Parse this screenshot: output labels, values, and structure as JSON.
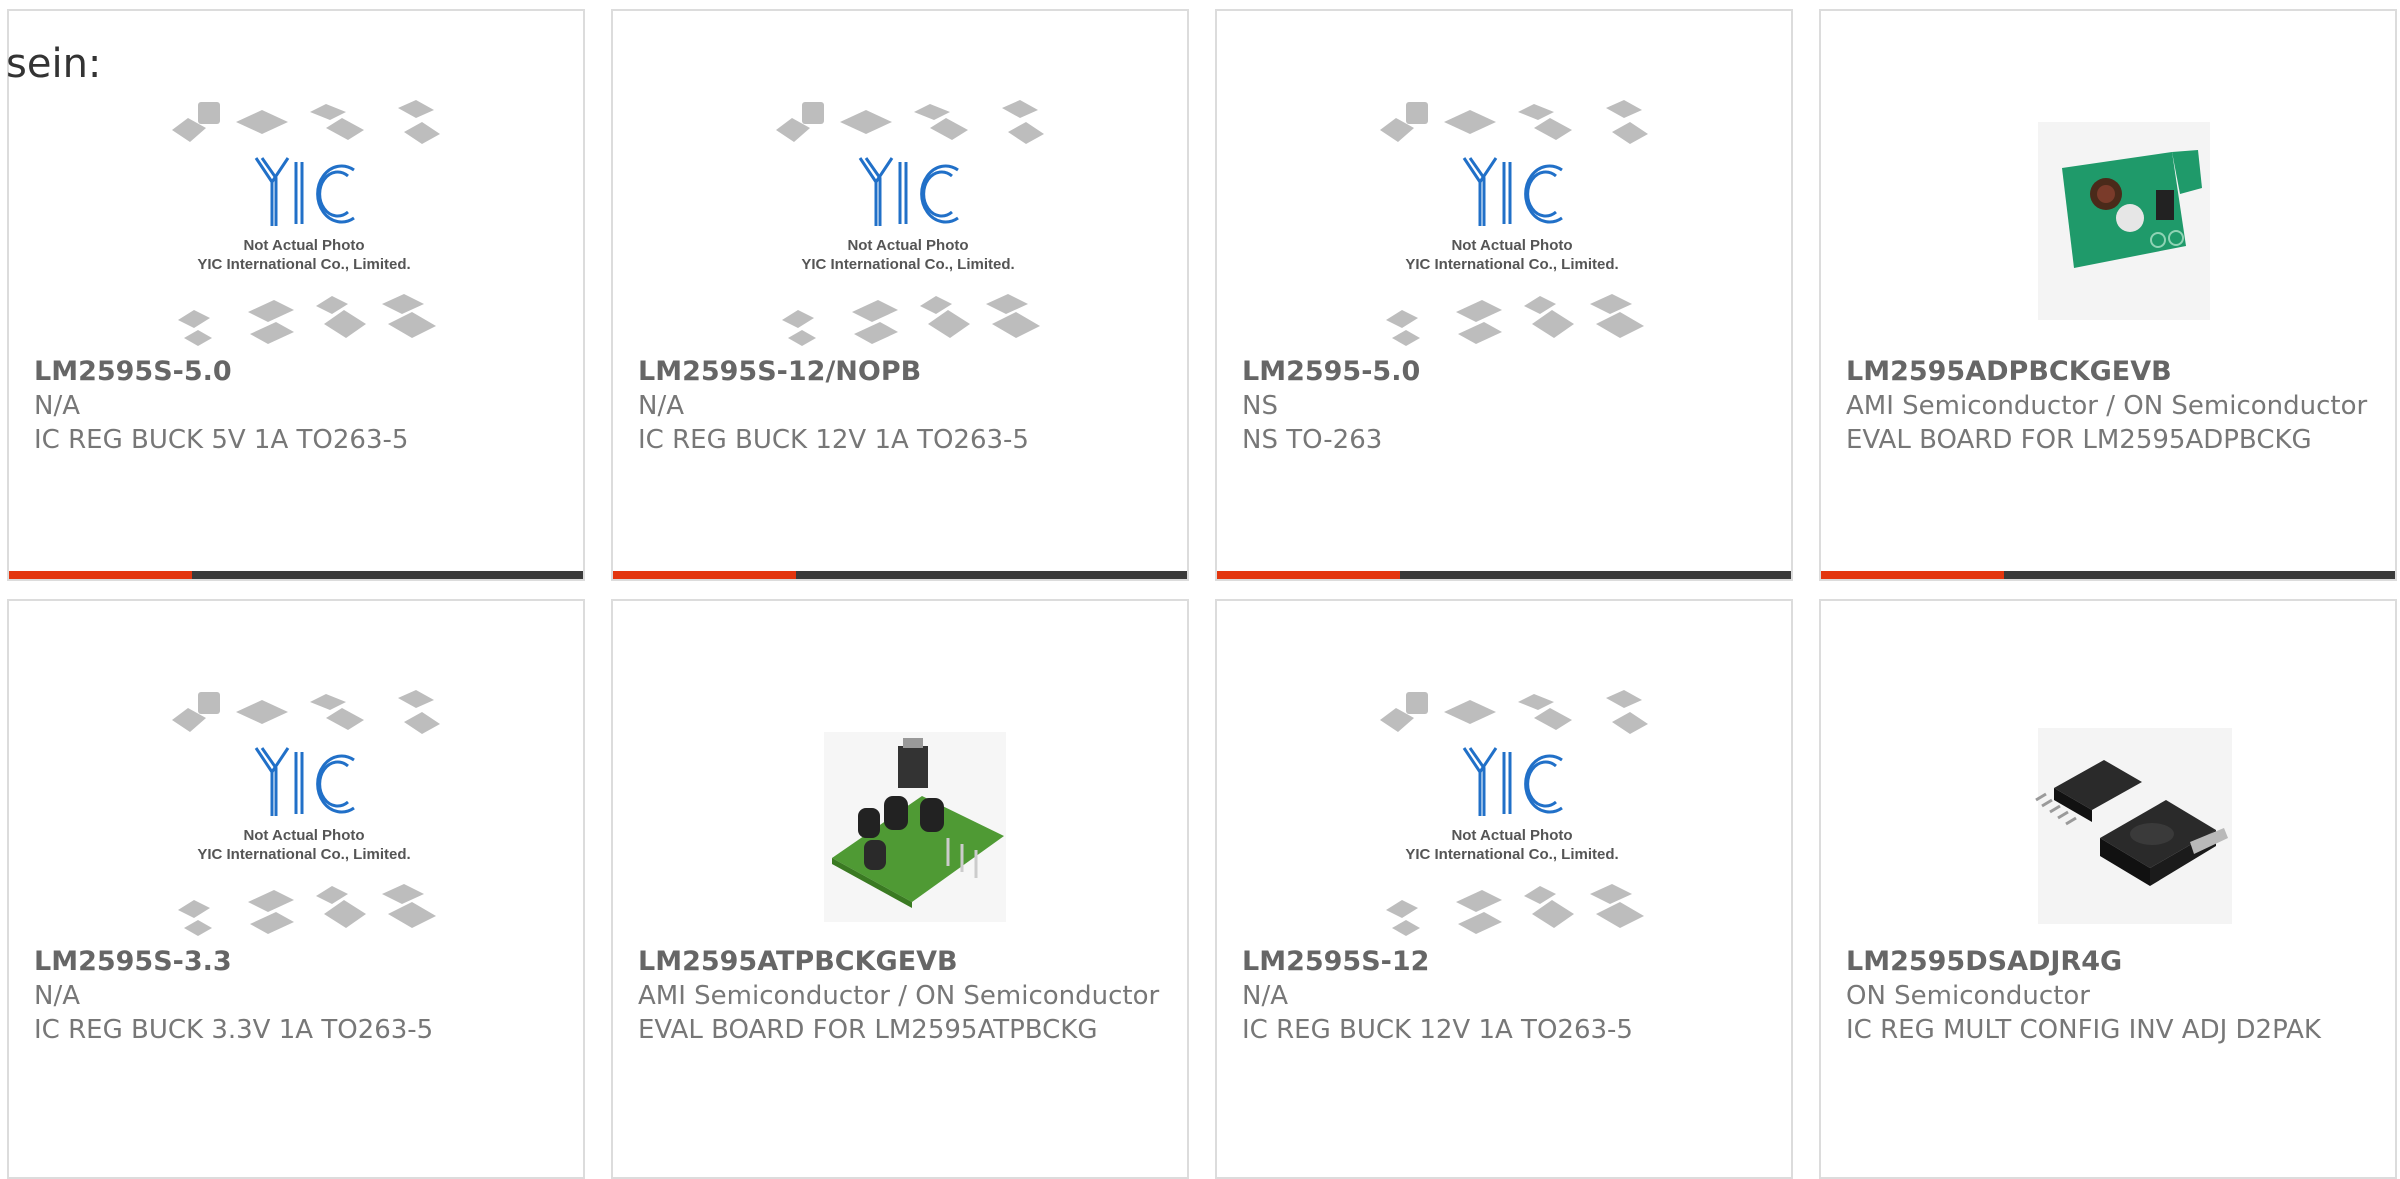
{
  "intro_text": "sein:",
  "placeholder_image": {
    "line1": "Not Actual Photo",
    "line2": "YIC International Co., Limited.",
    "logo": "YIC"
  },
  "colors": {
    "accent": "#e3360f",
    "bar": "#3a3a3a",
    "logo_blue": "#1e6fd0"
  },
  "products": [
    {
      "part": "LM2595S-5.0",
      "manufacturer": "N/A",
      "description": "IC REG BUCK 5V 1A TO263-5",
      "image": "placeholder"
    },
    {
      "part": "LM2595S-12/NOPB",
      "manufacturer": "N/A",
      "description": "IC REG BUCK 12V 1A TO263-5",
      "image": "placeholder"
    },
    {
      "part": "LM2595-5.0",
      "manufacturer": "NS",
      "description": "NS TO-263",
      "image": "placeholder"
    },
    {
      "part": "LM2595ADPBCKGEVB",
      "manufacturer": "AMI Semiconductor / ON Semiconductor",
      "description": "EVAL BOARD FOR LM2595ADPBCKG",
      "image": "green-pcb-photo"
    },
    {
      "part": "LM2595S-3.3",
      "manufacturer": "N/A",
      "description": "IC REG BUCK 3.3V 1A TO263-5",
      "image": "placeholder"
    },
    {
      "part": "LM2595ATPBCKGEVB",
      "manufacturer": "AMI Semiconductor / ON Semiconductor",
      "description": "EVAL BOARD FOR LM2595ATPBCKG",
      "image": "eval-board-photo"
    },
    {
      "part": "LM2595S-12",
      "manufacturer": "N/A",
      "description": "IC REG BUCK 12V 1A TO263-5",
      "image": "placeholder"
    },
    {
      "part": "LM2595DSADJR4G",
      "manufacturer": "ON Semiconductor",
      "description": "IC REG MULT CONFIG INV ADJ D2PAK",
      "image": "d2pak-chip-photo"
    }
  ]
}
